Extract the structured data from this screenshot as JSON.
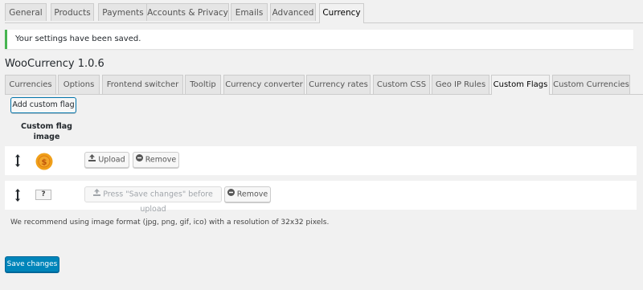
{
  "top_tabs": [
    "General",
    "Products",
    "Payments",
    "Accounts & Privacy",
    "Emails",
    "Advanced",
    "Currency"
  ],
  "top_tabs_active": "Currency",
  "notice": "Your settings have been saved.",
  "plugin_title": "WooCurrency 1.0.6",
  "sub_tabs": [
    "Currencies",
    "Options",
    "Frontend switcher",
    "Tooltip",
    "Currency converter",
    "Currency rates",
    "Custom CSS",
    "Geo IP Rules",
    "Custom Flags",
    "Custom Currencies"
  ],
  "sub_tabs_active": "Custom Flags",
  "add_button": "Add custom flag",
  "column_header": "Custom flag image",
  "rows": [
    {
      "flag": "coin-flag-icon",
      "upload_label": "Upload",
      "remove_label": "Remove"
    },
    {
      "flag": "question-mark-flag-icon",
      "placeholder_text": "?",
      "upload_label": "Press \"Save changes\" before upload",
      "remove_label": "Remove"
    }
  ],
  "help_text": "We recommend using image format (jpg, png, gif, ico) with a resolution of 32x32 pixels.",
  "save_button": "Save changes",
  "colors": {
    "accent": "#0085ba",
    "success": "#46b450",
    "coin": "#f0a01a"
  }
}
